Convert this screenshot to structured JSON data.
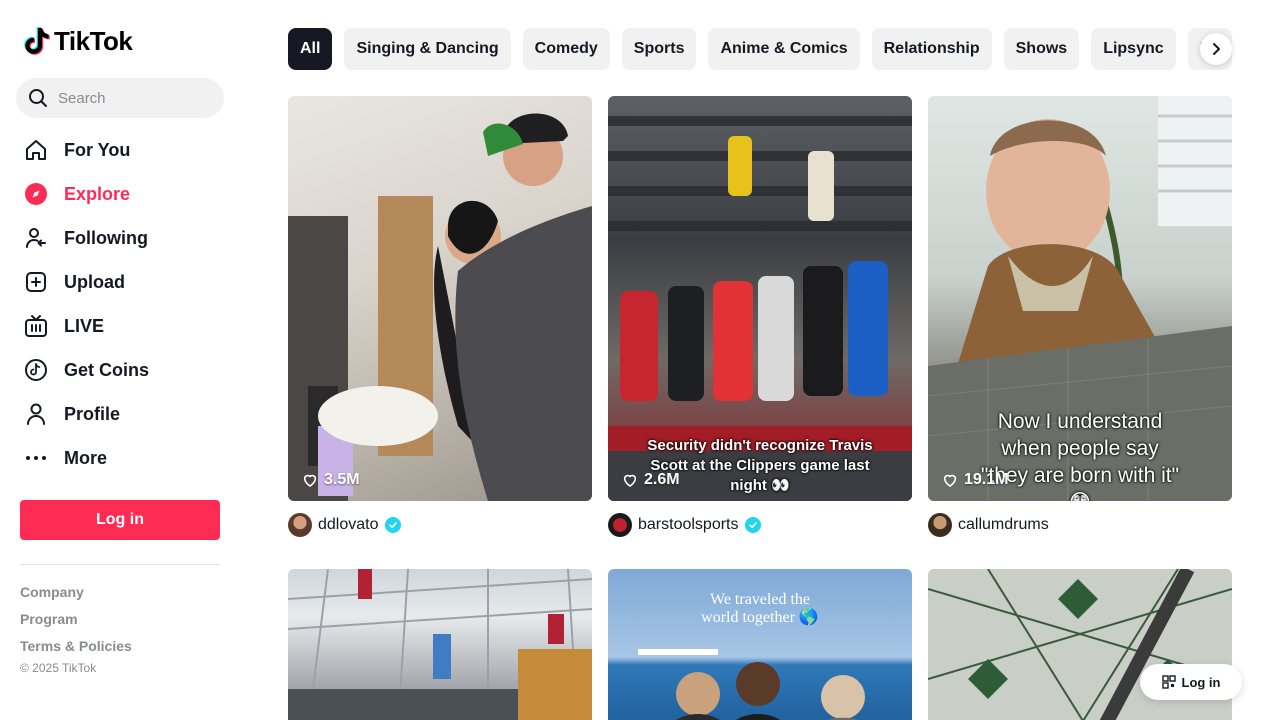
{
  "app": {
    "name": "TikTok"
  },
  "search": {
    "placeholder": "Search"
  },
  "nav": [
    {
      "label": "For You",
      "icon": "home-icon"
    },
    {
      "label": "Explore",
      "icon": "compass-icon",
      "active": true
    },
    {
      "label": "Following",
      "icon": "following-icon"
    },
    {
      "label": "Upload",
      "icon": "upload-icon"
    },
    {
      "label": "LIVE",
      "icon": "live-icon"
    },
    {
      "label": "Get Coins",
      "icon": "coins-icon"
    },
    {
      "label": "Profile",
      "icon": "profile-icon"
    },
    {
      "label": "More",
      "icon": "more-icon"
    }
  ],
  "login_label": "Log in",
  "footer": {
    "links": [
      "Company",
      "Program",
      "Terms & Policies"
    ],
    "copyright": "© 2025 TikTok"
  },
  "categories": [
    "All",
    "Singing & Dancing",
    "Comedy",
    "Sports",
    "Anime & Comics",
    "Relationship",
    "Shows",
    "Lipsync",
    "Da"
  ],
  "videos": [
    {
      "likes": "3.5M",
      "author": "ddlovato",
      "verified": true,
      "caption": ""
    },
    {
      "likes": "2.6M",
      "author": "barstoolsports",
      "verified": true,
      "caption": "Security didn't recognize Travis Scott at the Clippers game last night 👀"
    },
    {
      "likes": "19.1M",
      "author": "callumdrums",
      "verified": false,
      "caption": "Now I understand when people say \"they are born with it\" 😳"
    }
  ],
  "second_row": [
    {
      "caption": ""
    },
    {
      "caption": "We traveled the world together 🌎"
    },
    {
      "caption": ""
    }
  ],
  "floating_login": "Log in",
  "colors": {
    "accent": "#fe2c55",
    "text": "#161823",
    "muted": "#8a8b91",
    "chip": "#f1f1f2",
    "verified": "#20d5ec"
  }
}
